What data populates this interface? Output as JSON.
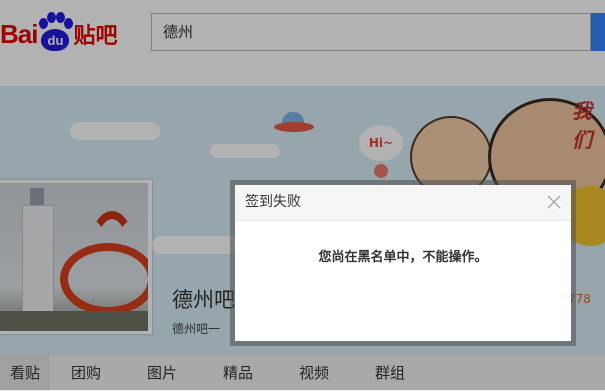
{
  "header": {
    "logo": {
      "bai": "Bai",
      "du": "du",
      "tieba": "贴吧"
    },
    "search": {
      "value": "德州"
    }
  },
  "banner": {
    "speech_bubble": "Hi~",
    "corner_text": "我们",
    "forum_title": "德州吧",
    "forum_desc": "德州吧一",
    "member_count": "778"
  },
  "nav": {
    "tabs": [
      {
        "label": "看贴"
      },
      {
        "label": "团购"
      },
      {
        "label": "图片"
      },
      {
        "label": "精品"
      },
      {
        "label": "视频"
      },
      {
        "label": "群组"
      }
    ]
  },
  "dialog": {
    "title": "签到失败",
    "message": "您尚在黑名单中，不能操作。"
  },
  "colors": {
    "brand_red": "#e10601",
    "brand_blue": "#2319dc",
    "search_button": "#3385ff",
    "overlay": "rgba(0,0,0,0.30)"
  }
}
